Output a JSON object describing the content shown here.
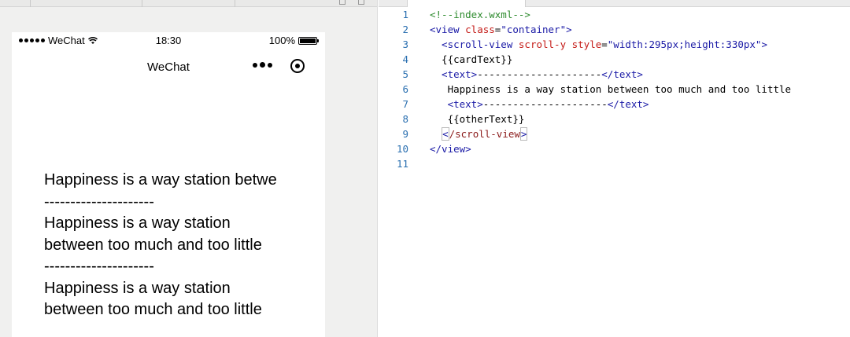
{
  "simulator": {
    "status_bar": {
      "carrier": "WeChat",
      "time": "18:30",
      "battery_percent": "100%",
      "battery_level": 1.0
    },
    "nav": {
      "title": "WeChat",
      "more_icon": "more-dots-icon",
      "home_icon": "target-circle-icon"
    },
    "content_lines": [
      "Happiness is a way station between too much and too little",
      "---------------------",
      "Happiness is a way station",
      "between too much and too little",
      "---------------------",
      "Happiness is a way station",
      "between too much and too little"
    ]
  },
  "editor": {
    "lines": [
      {
        "n": "1",
        "parts": [
          {
            "t": "<!--index.wxml-->",
            "c": "c-comment"
          }
        ]
      },
      {
        "n": "2",
        "parts": [
          {
            "t": "<view ",
            "c": "c-tag"
          },
          {
            "t": "class",
            "c": "c-attr"
          },
          {
            "t": "=",
            "c": "c-text"
          },
          {
            "t": "\"container\"",
            "c": "c-str"
          },
          {
            "t": ">",
            "c": "c-tag"
          }
        ]
      },
      {
        "n": "3",
        "parts": [
          {
            "t": "  <scroll-view ",
            "c": "c-tag"
          },
          {
            "t": "scroll-y style",
            "c": "c-attr"
          },
          {
            "t": "=",
            "c": "c-text"
          },
          {
            "t": "\"width:295px;height:330px\"",
            "c": "c-str"
          },
          {
            "t": ">",
            "c": "c-tag"
          }
        ]
      },
      {
        "n": "4",
        "parts": [
          {
            "t": "  {{cardText}}",
            "c": "c-text"
          }
        ]
      },
      {
        "n": "5",
        "parts": [
          {
            "t": "  <text>",
            "c": "c-tag"
          },
          {
            "t": "---------------------",
            "c": "c-text"
          },
          {
            "t": "</text>",
            "c": "c-tag"
          }
        ]
      },
      {
        "n": "6",
        "parts": [
          {
            "t": "   Happiness is a way station between too much and too little",
            "c": "c-text"
          }
        ]
      },
      {
        "n": "7",
        "parts": [
          {
            "t": "   <text>",
            "c": "c-tag"
          },
          {
            "t": "---------------------",
            "c": "c-text"
          },
          {
            "t": "</text>",
            "c": "c-tag"
          }
        ]
      },
      {
        "n": "8",
        "parts": [
          {
            "t": "   {{otherText}}",
            "c": "c-text"
          }
        ]
      },
      {
        "n": "9",
        "parts": [
          {
            "t": "  ",
            "c": "c-text"
          },
          {
            "t": "<",
            "c": "c-tag cursor-box"
          },
          {
            "t": "/scroll-view",
            "c": "c-tag2"
          },
          {
            "t": ">",
            "c": "c-tag cursor-box"
          }
        ]
      },
      {
        "n": "10",
        "parts": [
          {
            "t": "</view>",
            "c": "c-tag"
          }
        ]
      },
      {
        "n": "11",
        "parts": []
      }
    ]
  }
}
